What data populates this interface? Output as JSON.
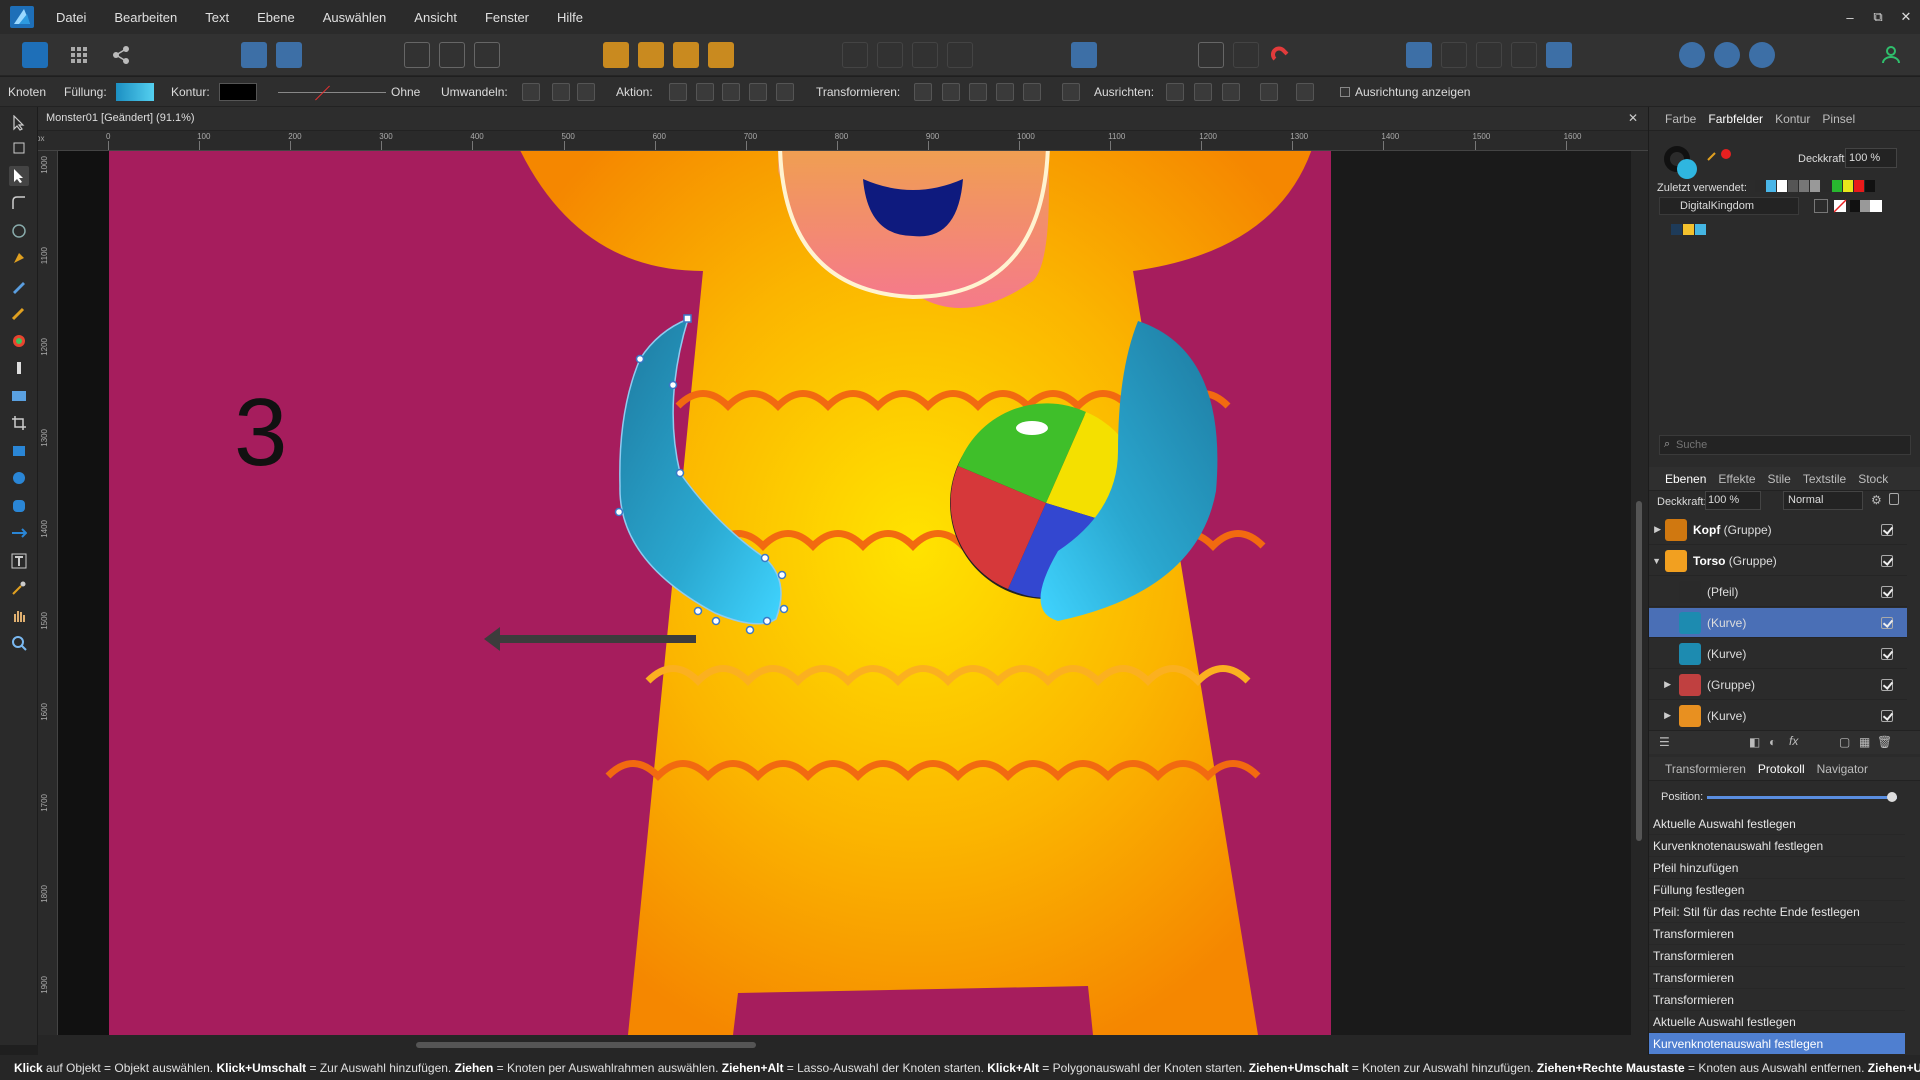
{
  "app": {
    "menu": [
      "Datei",
      "Bearbeiten",
      "Text",
      "Ebene",
      "Auswählen",
      "Ansicht",
      "Fenster",
      "Hilfe"
    ],
    "window_controls": [
      "–",
      "⧉",
      "✕"
    ]
  },
  "contextbar": {
    "tool_label": "Knoten",
    "fill_label": "Füllung:",
    "stroke_label": "Kontur:",
    "stroke_none": "Ohne",
    "convert_label": "Umwandeln:",
    "action_label": "Aktion:",
    "transform_label": "Transformieren:",
    "align_label": "Ausrichten:",
    "show_align_label": "Ausrichtung anzeigen",
    "fill_color": "#2fb6e0",
    "stroke_color": "#000000"
  },
  "document": {
    "title": "Monster01 [Geändert] (91.1%)",
    "close": "✕",
    "ruler_unit": "px",
    "ruler_h_ticks": [
      "0",
      "100",
      "200",
      "300",
      "400",
      "500",
      "600",
      "700",
      "800",
      "900",
      "1000",
      "1100",
      "1200",
      "1300",
      "1400",
      "1500",
      "1600"
    ],
    "ruler_v_ticks": [
      "1000",
      "1100",
      "1200",
      "1300",
      "1400",
      "1500",
      "1600",
      "1700",
      "1800",
      "1900"
    ],
    "step_number": "3"
  },
  "swatches_panel": {
    "tabs": [
      "Farbe",
      "Farbfelder",
      "Kontur",
      "Pinsel"
    ],
    "active_tab": "Farbfelder",
    "opacity_label": "Deckkraft:",
    "opacity_value": "100 %",
    "recent_label": "Zuletzt verwendet:",
    "palette_name": "DigitalKingdom",
    "search_placeholder": "Suche",
    "recent_colors": [
      "#2a2a2a",
      "#4ab6e8",
      "#ffffff",
      "#555555",
      "#777777",
      "#999999",
      "#2a2a2a",
      "#28b82f",
      "#e8e81a",
      "#e81a1a",
      "#111111"
    ],
    "palette_colors": [
      "#2b2b2b",
      "#1e3b59",
      "#f2c12e",
      "#45b6e3"
    ]
  },
  "layers_panel": {
    "tabs": [
      "Ebenen",
      "Effekte",
      "Stile",
      "Textstile",
      "Stock"
    ],
    "active_tab": "Ebenen",
    "opacity_label": "Deckkraft:",
    "opacity_value": "100 %",
    "blend_mode": "Normal",
    "layers": [
      {
        "name": "Kopf",
        "type": " (Gruppe)",
        "bold": true,
        "selected": false
      },
      {
        "name": "Torso",
        "type": " (Gruppe)",
        "bold": true,
        "selected": false
      },
      {
        "name": "",
        "type": "(Pfeil)",
        "bold": false,
        "selected": false
      },
      {
        "name": "",
        "type": "(Kurve)",
        "bold": false,
        "selected": true
      },
      {
        "name": "",
        "type": "(Kurve)",
        "bold": false,
        "selected": false
      },
      {
        "name": "",
        "type": "(Gruppe)",
        "bold": false,
        "selected": false
      },
      {
        "name": "",
        "type": "(Kurve)",
        "bold": false,
        "selected": false
      }
    ]
  },
  "history_panel": {
    "tabs": [
      "Transformieren",
      "Protokoll",
      "Navigator"
    ],
    "active_tab": "Protokoll",
    "position_label": "Position:",
    "position_value": 1.0,
    "entries": [
      "Aktuelle Auswahl festlegen",
      "Kurvenknotenauswahl festlegen",
      "Pfeil hinzufügen",
      "Füllung festlegen",
      "Pfeil: Stil für das rechte Ende festlegen",
      "Transformieren",
      "Transformieren",
      "Transformieren",
      "Transformieren",
      "Aktuelle Auswahl festlegen",
      "Kurvenknotenauswahl festlegen"
    ],
    "selected_index": 10
  },
  "statusbar": {
    "parts": [
      {
        "b": "Klick",
        "t": " auf Objekt = Objekt auswählen. "
      },
      {
        "b": "Klick+Umschalt",
        "t": " = Zur Auswahl hinzufügen. "
      },
      {
        "b": "Ziehen",
        "t": " = Knoten per Auswahlrahmen auswählen. "
      },
      {
        "b": "Ziehen+Alt",
        "t": " = Lasso-Auswahl der Knoten starten. "
      },
      {
        "b": "Klick+Alt",
        "t": " = Polygonauswahl der Knoten starten. "
      },
      {
        "b": "Ziehen+Umschalt",
        "t": " = Knoten zur Auswahl hinzufügen. "
      },
      {
        "b": "Ziehen+Rechte Maustaste",
        "t": " = Knoten aus Auswahl entfernen. "
      },
      {
        "b": "Ziehen+Un",
        "t": ""
      }
    ]
  }
}
